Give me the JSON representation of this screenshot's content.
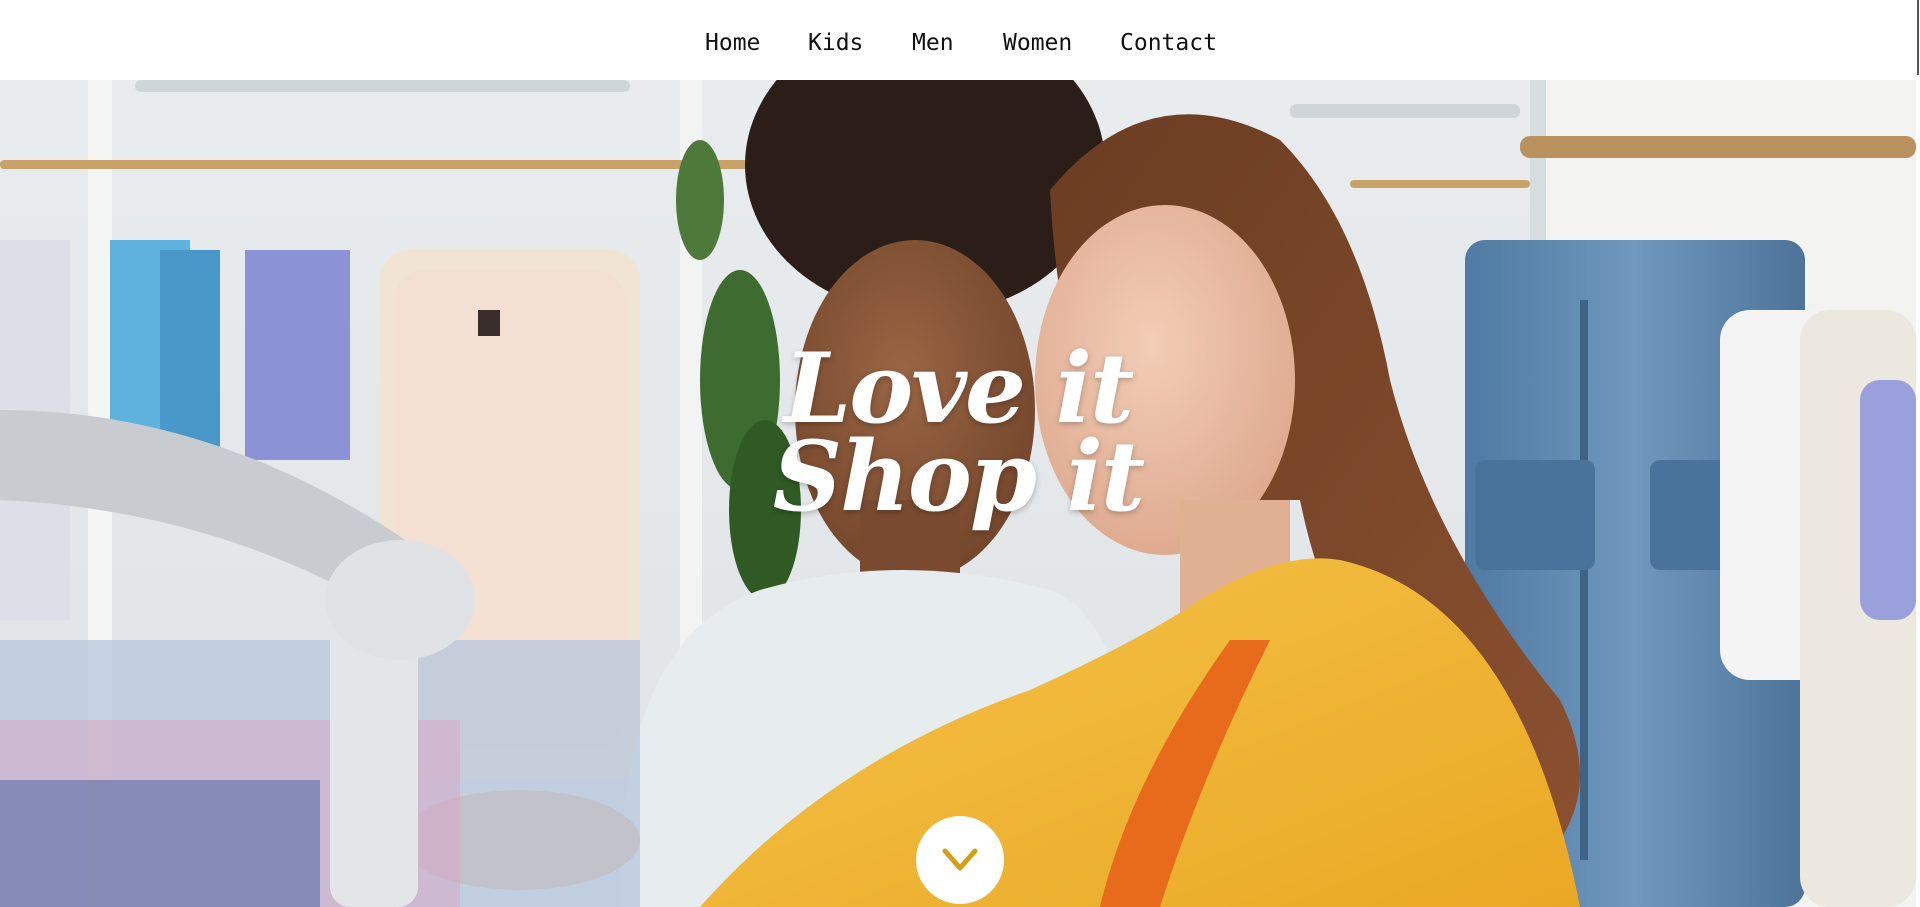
{
  "nav": {
    "items": [
      {
        "label": "Home"
      },
      {
        "label": "Kids"
      },
      {
        "label": "Men"
      },
      {
        "label": "Women"
      },
      {
        "label": "Contact"
      }
    ]
  },
  "hero": {
    "tagline_line1": "Love it",
    "tagline_line2": "Shop it",
    "scroll_icon": "chevron-down-icon",
    "image_subject": "two women browsing clothes on rails in a boutique",
    "colors": {
      "accent": "#d4a017",
      "jacket": "#f2b630",
      "denim": "#5d86ad"
    }
  }
}
